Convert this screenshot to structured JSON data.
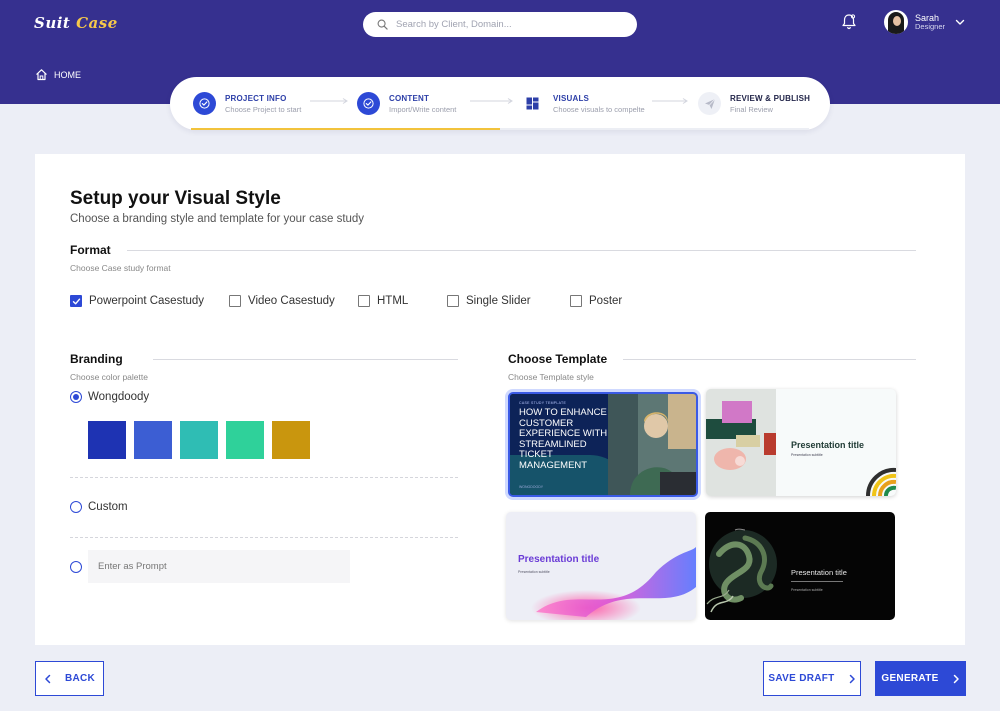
{
  "app": {
    "logo_main": "Suit ",
    "logo_accent": "Case",
    "search_placeholder": "Search by Client, Domain...",
    "user_name": "Sarah",
    "user_role": "Designer",
    "home_label": "HOME"
  },
  "stepper": {
    "progress": 0.5,
    "steps": [
      {
        "title": "PROJECT INFO",
        "subtitle": "Choose Project to start",
        "status": "done",
        "icon": "check-icon"
      },
      {
        "title": "CONTENT",
        "subtitle": "Import/Write content",
        "status": "done",
        "icon": "check-icon"
      },
      {
        "title": "VISUALS",
        "subtitle": "Choose visuals to compelte",
        "status": "current",
        "icon": "layout-icon"
      },
      {
        "title": "REVIEW & PUBLISH",
        "subtitle": "Final Review",
        "status": "todo",
        "icon": "send-icon"
      }
    ]
  },
  "page": {
    "title": "Setup your Visual Style",
    "subtitle": "Choose a branding style and template for your case study"
  },
  "format": {
    "label": "Format",
    "hint": "Choose Case study format",
    "options": [
      {
        "label": "Powerpoint Casestudy",
        "checked": true
      },
      {
        "label": "Video Casestudy",
        "checked": false
      },
      {
        "label": "HTML",
        "checked": false
      },
      {
        "label": "Single Slider",
        "checked": false
      },
      {
        "label": "Poster",
        "checked": false
      }
    ]
  },
  "branding": {
    "label": "Branding",
    "hint": "Choose color palette",
    "palette_option": "Wongdoody",
    "palette_colors": [
      "#1e33b3",
      "#3c5ed3",
      "#2fbdb4",
      "#2fd19a",
      "#c9960e"
    ],
    "custom_option": "Custom",
    "prompt_placeholder": "Enter as Prompt",
    "selected": "Wongdoody"
  },
  "template": {
    "label": "Choose Template",
    "hint": "Choose Template style",
    "items": [
      {
        "small": "CASE STUDY TEMPLATE",
        "title": "HOW TO ENHANCE CUSTOMER EXPERIENCE WITH STREAMLINED TICKET MANAGEMENT",
        "footer": "WONGDOODY",
        "selected": true
      },
      {
        "title": "Presentation title",
        "subtitle": "Presentation subtitle",
        "selected": false
      },
      {
        "title": "Presentation title",
        "subtitle": "Presentation subtitle",
        "selected": false
      },
      {
        "title": "Presentation title",
        "subtitle": "Presentation subtitle",
        "selected": false
      }
    ]
  },
  "actions": {
    "back": "BACK",
    "save_draft": "SAVE DRAFT",
    "generate": "GENERATE"
  },
  "colors": {
    "header": "#36308f",
    "primary": "#2d49d6",
    "progress": "#f2c33c",
    "background": "#eceef6"
  }
}
